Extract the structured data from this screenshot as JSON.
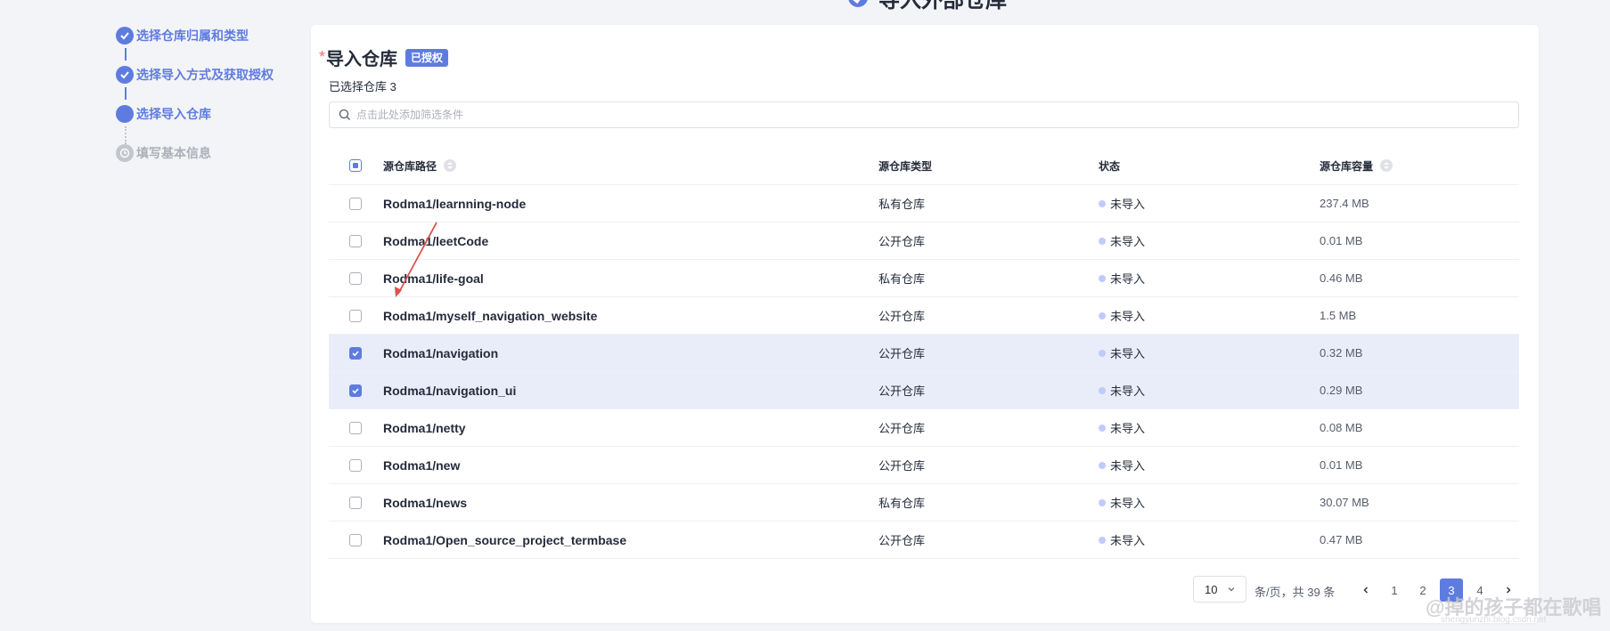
{
  "top_title": "导入外部仓库",
  "steps": [
    {
      "label": "选择仓库归属和类型",
      "state": "done"
    },
    {
      "label": "选择导入方式及获取授权",
      "state": "done"
    },
    {
      "label": "选择导入仓库",
      "state": "current"
    },
    {
      "label": "填写基本信息",
      "state": "pending"
    }
  ],
  "section": {
    "required_mark": "*",
    "title": "导入仓库",
    "badge": "已授权",
    "selected_count": "已选择仓库 3",
    "filter_placeholder": "点击此处添加筛选条件"
  },
  "table": {
    "headers": {
      "path": "源仓库路径",
      "type": "源仓库类型",
      "status": "状态",
      "size": "源仓库容量"
    },
    "header_checkbox": "partial",
    "rows": [
      {
        "path": "Rodma1/learnning-node",
        "type": "私有仓库",
        "status": "未导入",
        "size": "237.4 MB",
        "checked": false
      },
      {
        "path": "Rodma1/leetCode",
        "type": "公开仓库",
        "status": "未导入",
        "size": "0.01 MB",
        "checked": false
      },
      {
        "path": "Rodma1/life-goal",
        "type": "私有仓库",
        "status": "未导入",
        "size": "0.46 MB",
        "checked": false
      },
      {
        "path": "Rodma1/myself_navigation_website",
        "type": "公开仓库",
        "status": "未导入",
        "size": "1.5 MB",
        "checked": false
      },
      {
        "path": "Rodma1/navigation",
        "type": "公开仓库",
        "status": "未导入",
        "size": "0.32 MB",
        "checked": true
      },
      {
        "path": "Rodma1/navigation_ui",
        "type": "公开仓库",
        "status": "未导入",
        "size": "0.29 MB",
        "checked": true
      },
      {
        "path": "Rodma1/netty",
        "type": "公开仓库",
        "status": "未导入",
        "size": "0.08 MB",
        "checked": false
      },
      {
        "path": "Rodma1/new",
        "type": "公开仓库",
        "status": "未导入",
        "size": "0.01 MB",
        "checked": false
      },
      {
        "path": "Rodma1/news",
        "type": "私有仓库",
        "status": "未导入",
        "size": "30.07 MB",
        "checked": false
      },
      {
        "path": "Rodma1/Open_source_project_termbase",
        "type": "公开仓库",
        "status": "未导入",
        "size": "0.47 MB",
        "checked": false
      }
    ]
  },
  "pagination": {
    "page_size": "10",
    "per_page_text": "条/页，共 39 条",
    "pages": [
      "1",
      "2",
      "3",
      "4"
    ],
    "current_page": "3"
  },
  "watermark": "@掉的孩子都在歌唱",
  "watermark_sub": "shengyunzhi.blog.csdn.net",
  "colors": {
    "accent": "#5e7ce0",
    "row_selected": "#e9edfa",
    "status_dot": "#beccfa",
    "required": "#f66f6a",
    "annotation_arrow": "#d9534f"
  },
  "icons": [
    "check-icon",
    "search-icon",
    "sort-icon",
    "chevron-down-icon",
    "chevron-left-icon",
    "chevron-right-icon",
    "clock-icon",
    "app-logo-icon"
  ]
}
